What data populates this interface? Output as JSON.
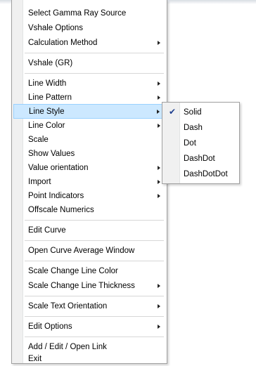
{
  "menu": {
    "items": [
      {
        "label": "Select Gamma Ray Source",
        "submenu": false
      },
      {
        "label": "Vshale Options",
        "submenu": false
      },
      {
        "label": "Calculation Method",
        "submenu": true
      },
      {
        "label": "Vshale (GR)",
        "submenu": false
      },
      {
        "label": "Line Width",
        "submenu": true
      },
      {
        "label": "Line Pattern",
        "submenu": true
      },
      {
        "label": "Line Style",
        "submenu": true,
        "highlighted": true
      },
      {
        "label": "Line Color",
        "submenu": true
      },
      {
        "label": "Scale",
        "submenu": false
      },
      {
        "label": "Show Values",
        "submenu": false
      },
      {
        "label": "Value orientation",
        "submenu": true
      },
      {
        "label": "Import",
        "submenu": true
      },
      {
        "label": "Point Indicators",
        "submenu": true
      },
      {
        "label": "Offscale Numerics",
        "submenu": false
      },
      {
        "label": "Edit Curve",
        "submenu": false
      },
      {
        "label": "Open Curve Average Window",
        "submenu": false
      },
      {
        "label": "Scale Change Line Color",
        "submenu": false
      },
      {
        "label": "Scale Change Line Thickness",
        "submenu": true
      },
      {
        "label": "Scale Text Orientation",
        "submenu": true
      },
      {
        "label": "Edit Options",
        "submenu": true
      },
      {
        "label": "Add / Edit / Open Link",
        "submenu": false
      },
      {
        "label": "Exit",
        "submenu": false
      }
    ]
  },
  "line_style_submenu": {
    "items": [
      {
        "label": "Solid",
        "checked": true
      },
      {
        "label": "Dash",
        "checked": false
      },
      {
        "label": "Dot",
        "checked": false
      },
      {
        "label": "DashDot",
        "checked": false
      },
      {
        "label": "DashDotDot",
        "checked": false
      }
    ],
    "check_glyph": "✔"
  },
  "colors": {
    "highlight_bg": "#cce8ff",
    "highlight_border": "#99d1ff",
    "gutter": "#f0f0f0"
  }
}
